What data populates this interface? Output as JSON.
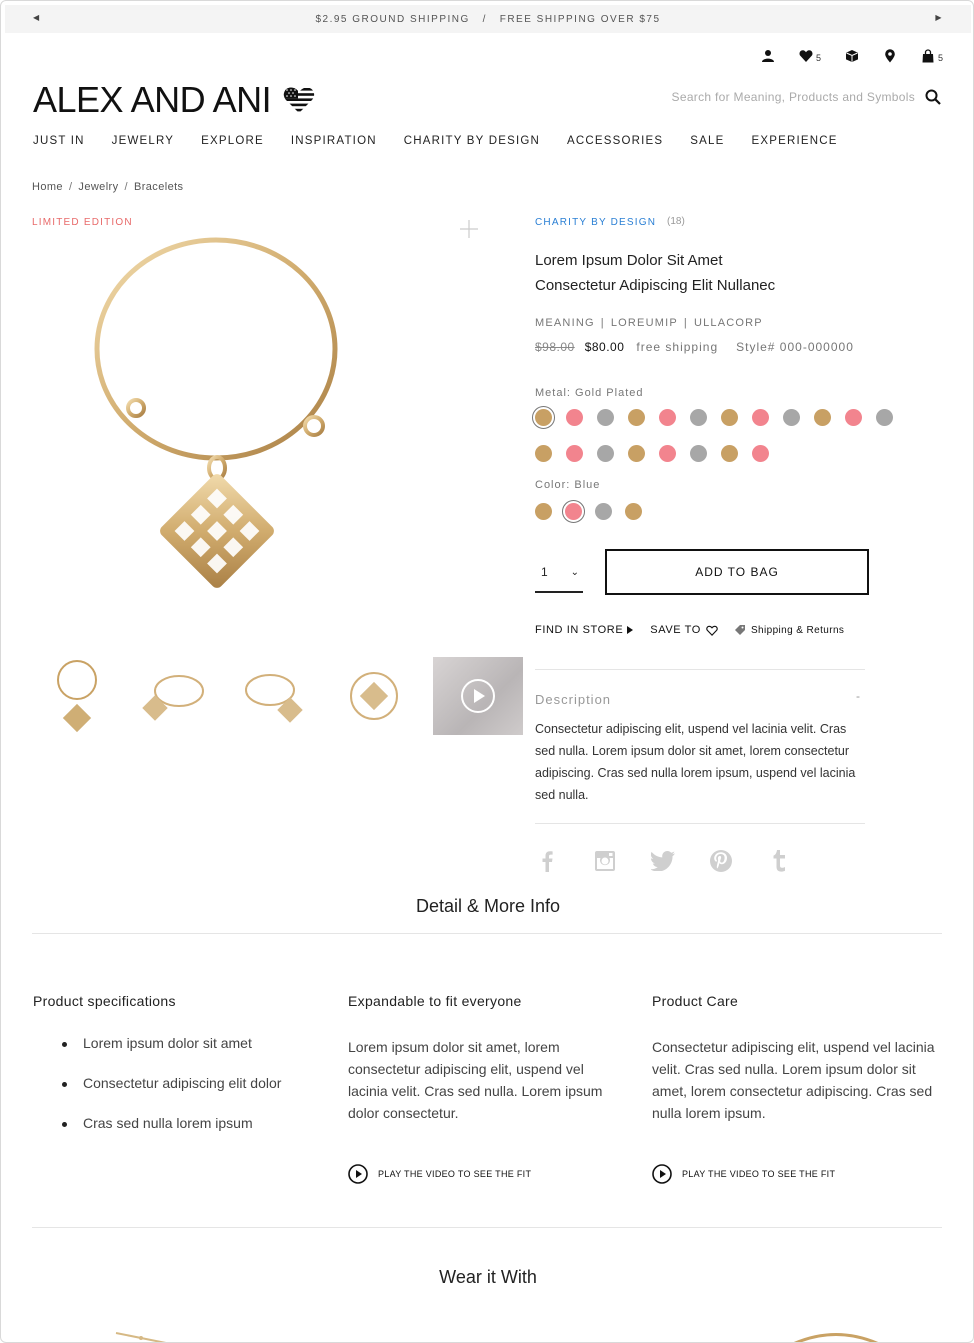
{
  "promo": {
    "message": "$2.95 GROUND SHIPPING   /   FREE SHIPPING OVER $75"
  },
  "utility": {
    "wishlist_count": "5",
    "bag_count": "5"
  },
  "brand": {
    "logo_text": "ALEX AND ANI"
  },
  "search": {
    "placeholder": "Search for Meaning, Products and Symbols"
  },
  "nav": {
    "items": [
      "JUST IN",
      "JEWELRY",
      "EXPLORE",
      "INSPIRATION",
      "CHARITY BY DESIGN",
      "ACCESSORIES",
      "SALE",
      "EXPERIENCE"
    ]
  },
  "breadcrumb": {
    "items": [
      "Home",
      "Jewelry",
      "Bracelets"
    ]
  },
  "product": {
    "badge": "LIMITED EDITION",
    "collection": "CHARITY BY DESIGN",
    "review_count": "(18)",
    "title_line1": "Lorem Ipsum Dolor Sit Amet",
    "title_line2": "Consectetur Adipiscing Elit Nullanec",
    "meanings": [
      "MEANING",
      "LOREUMIP",
      "ULLACORP"
    ],
    "old_price": "$98.00",
    "price": "$80.00",
    "shipping_note": "free shipping",
    "style_number": "Style# 000-000000",
    "metal_label": "Metal: Gold Plated",
    "color_label": "Color: Blue",
    "quantity": "1",
    "add_to_bag": "ADD TO BAG",
    "find_in_store": "FIND IN STORE",
    "save_to": "SAVE TO",
    "shipping_returns": "Shipping & Returns",
    "description_label": "Description",
    "description_toggle": "-",
    "description": "Consectetur adipiscing elit, uspend vel lacinia velit. Cras sed nulla. Lorem ipsum dolor sit amet, lorem consectetur adipiscing. Cras sed nulla lorem ipsum, uspend vel lacinia sed nulla."
  },
  "colors": {
    "gold": "#c8a064",
    "pink": "#f2848e",
    "silver": "#a7a7a7",
    "link_blue": "#2a7fd4",
    "badge_red": "#e86a6a"
  },
  "swatches": {
    "metal_row1": [
      "gold",
      "pink",
      "silver",
      "gold",
      "pink",
      "silver",
      "gold",
      "pink",
      "silver",
      "gold",
      "pink",
      "silver"
    ],
    "metal_row2": [
      "gold",
      "pink",
      "silver",
      "gold",
      "pink",
      "silver",
      "gold",
      "pink"
    ],
    "color_row": [
      "gold",
      "pink",
      "silver",
      "gold"
    ]
  },
  "details": {
    "title": "Detail & More Info",
    "spec_title": "Product specifications",
    "spec_items": [
      "Lorem ipsum dolor sit amet",
      "Consectetur adipiscing elit dolor",
      "Cras sed nulla lorem ipsum"
    ],
    "fit_title": "Expandable to fit everyone",
    "fit_body": "Lorem ipsum dolor sit amet, lorem consectetur adipiscing elit, uspend vel lacinia velit. Cras sed nulla. Lorem ipsum dolor consectetur.",
    "fit_video": "PLAY THE VIDEO TO SEE THE FIT",
    "care_title": "Product Care",
    "care_body": "Consectetur adipiscing elit, uspend vel lacinia velit. Cras sed nulla. Lorem ipsum dolor sit amet, lorem consectetur adipiscing. Cras sed nulla lorem ipsum.",
    "care_video": "PLAY THE VIDEO TO SEE THE FIT"
  },
  "wear_with": {
    "title": "Wear it With"
  }
}
